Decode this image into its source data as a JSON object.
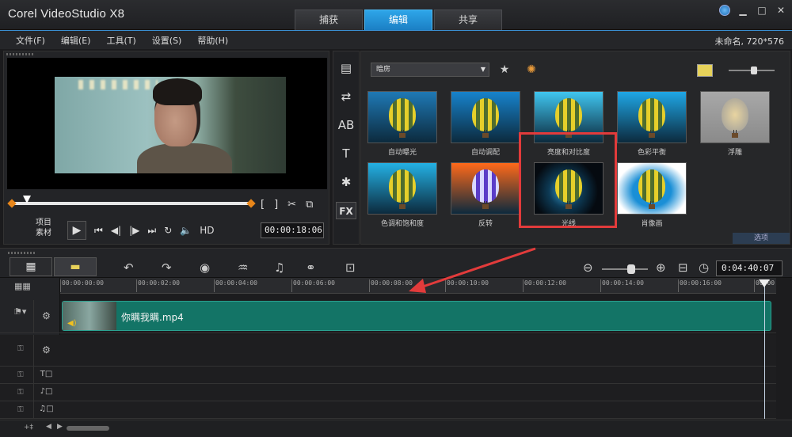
{
  "app": {
    "title": "Corel VideoStudio X8",
    "tabs": [
      {
        "label": "捕获",
        "active": false
      },
      {
        "label": "编辑",
        "active": true
      },
      {
        "label": "共享",
        "active": false
      }
    ],
    "window_controls": [
      "globe-icon",
      "minimize-icon",
      "maximize-icon",
      "close-icon"
    ]
  },
  "menu": {
    "items": [
      "文件(F)",
      "编辑(E)",
      "工具(T)",
      "设置(S)",
      "帮助(H)"
    ],
    "project_info": "未命名, 720*576"
  },
  "player": {
    "mode_labels": [
      "项目",
      "素材"
    ],
    "timecode": "00:00:18:06",
    "hd_label": "HD",
    "bracket_in": "[",
    "bracket_out": "]"
  },
  "library": {
    "category": "暗房",
    "effects": [
      {
        "label": "自动曝光",
        "bg": "#1f79b5"
      },
      {
        "label": "自动调配",
        "bg": "#1783cc"
      },
      {
        "label": "亮度和对比度",
        "bg": "#40c6f0"
      },
      {
        "label": "色彩平衡",
        "bg": "#1fa7e6"
      },
      {
        "label": "浮雕",
        "bg": "#9a9a9a"
      },
      {
        "label": "色调和饱和度",
        "bg": "#24b1e4"
      },
      {
        "label": "反转",
        "bg": "#ff6a1a"
      },
      {
        "label": "光线",
        "bg": "#0b1a24"
      },
      {
        "label": "肖像画",
        "bg": "#f0f4f8"
      }
    ],
    "options_label": "选项"
  },
  "timeline": {
    "duration": "0:04:40:07",
    "ruler_ticks": [
      "00:00:00:00",
      "00:00:02:00",
      "00:00:04:00",
      "00:00:06:00",
      "00:00:08:00",
      "00:00:10:00",
      "00:00:12:00",
      "00:00:14:00",
      "00:00:16:00",
      "00:00"
    ],
    "clip_name": "你瞒我瞒.mp4"
  }
}
